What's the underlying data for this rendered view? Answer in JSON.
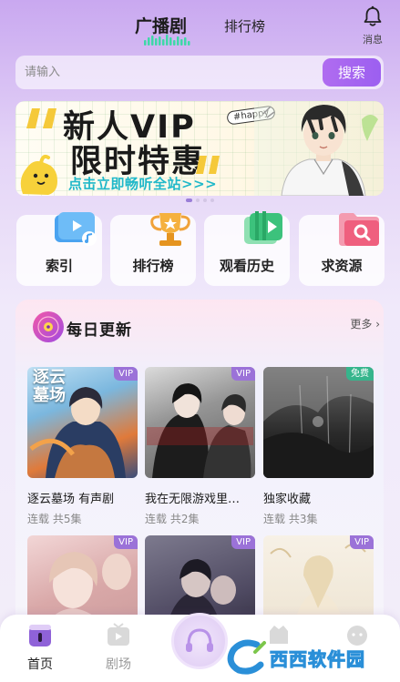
{
  "header": {
    "active_tab": "广播剧",
    "tab_ranking": "排行榜",
    "messages_label": "消息"
  },
  "search": {
    "placeholder": "请输入",
    "button": "搜索"
  },
  "banner": {
    "line1": "新人VIP",
    "line2": "限时特惠",
    "cta": "点击立即畅听全站>>>",
    "tag": "#happy",
    "dots": 4,
    "active_dot": 0
  },
  "shortcuts": [
    {
      "label": "索引",
      "icon": "video-index-icon",
      "color": "#4aa3f0"
    },
    {
      "label": "排行榜",
      "icon": "trophy-icon",
      "color": "#f0a23a"
    },
    {
      "label": "观看历史",
      "icon": "history-icon",
      "color": "#3cc27c"
    },
    {
      "label": "求资源",
      "icon": "search-folder-icon",
      "color": "#ef5f7e"
    }
  ],
  "daily": {
    "title": "每日更新",
    "more": "更多",
    "items": [
      {
        "title": "逐云墓场 有声剧",
        "meta": "连载 共5集",
        "badge": "VIP",
        "cover_text": "逐云\n墓场"
      },
      {
        "title": "我在无限游戏里…",
        "meta": "连载 共2集",
        "badge": "VIP",
        "cover_text": ""
      },
      {
        "title": "独家收藏",
        "meta": "连载 共3集",
        "badge": "免费",
        "cover_text": ""
      },
      {
        "title": "",
        "meta": "",
        "badge": "VIP",
        "cover_text": ""
      },
      {
        "title": "",
        "meta": "",
        "badge": "VIP",
        "cover_text": ""
      },
      {
        "title": "",
        "meta": "",
        "badge": "VIP",
        "cover_text": ""
      }
    ]
  },
  "tabbar": {
    "home": "首页",
    "theater": "剧场"
  },
  "watermark": "西西软件园",
  "colors": {
    "accent": "#9c5ff0",
    "badge_vip": "#9b72d8",
    "badge_free": "#36b58c",
    "cta_text": "#1fb8c9"
  }
}
